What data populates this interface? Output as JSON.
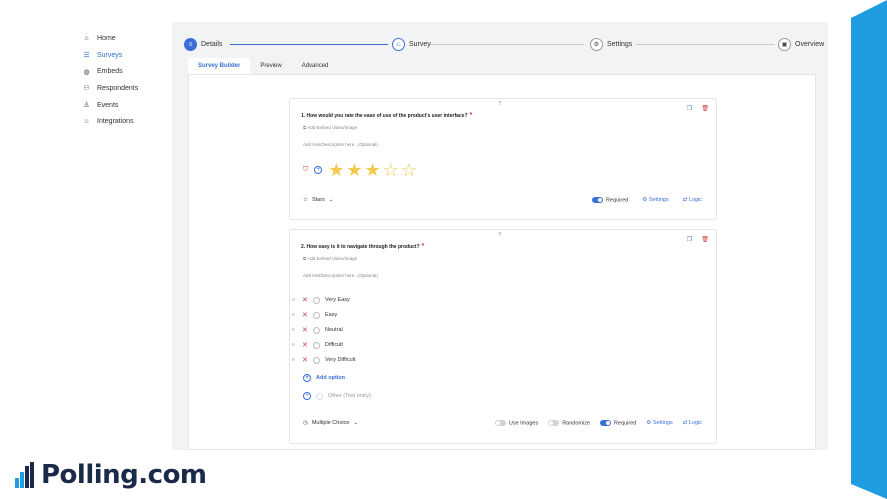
{
  "sidebar": {
    "items": [
      {
        "label": "Home",
        "icon": "home-icon"
      },
      {
        "label": "Surveys",
        "icon": "list-icon"
      },
      {
        "label": "Embeds",
        "icon": "embed-icon"
      },
      {
        "label": "Respondents",
        "icon": "users-icon"
      },
      {
        "label": "Events",
        "icon": "person-icon"
      },
      {
        "label": "Integrations",
        "icon": "bank-icon"
      }
    ],
    "active": "Surveys"
  },
  "stepper": {
    "steps": [
      {
        "label": "Details"
      },
      {
        "label": "Survey"
      },
      {
        "label": "Settings"
      },
      {
        "label": "Overview"
      }
    ]
  },
  "tabs": [
    {
      "label": "Survey Builder"
    },
    {
      "label": "Preview"
    },
    {
      "label": "Advanced"
    }
  ],
  "question1": {
    "title": "1.  How would you rate the ease of use of the product's user interface?",
    "required_mark": "*",
    "embed_label": "Add Embed Video/Image",
    "hint": "Add Hint/Description here...(Optional)",
    "rating": 3,
    "max_rating": 5,
    "type_label": "Stars",
    "required_label": "Required",
    "settings_label": "Settings",
    "logic_label": "Logic"
  },
  "question2": {
    "title": "2.  How easy is it to navigate through the product?",
    "required_mark": "*",
    "embed_label": "Add Embed Video/Image",
    "hint": "Add Hint/Description here...(Optional)",
    "options": [
      "Very Easy",
      "Easy",
      "Neutral",
      "Difficult",
      "Very Difficult"
    ],
    "add_option_label": "Add option",
    "other_label": "Other (Text entry)",
    "type_label": "Multiple Choice",
    "use_images_label": "Use Images",
    "randomize_label": "Randomize",
    "required_label": "Required",
    "settings_label": "Settings",
    "logic_label": "Logic"
  },
  "brand": {
    "name": "Polling.com",
    "accent_color": "#1e9ee0",
    "primary_color": "#3a6fd8"
  }
}
